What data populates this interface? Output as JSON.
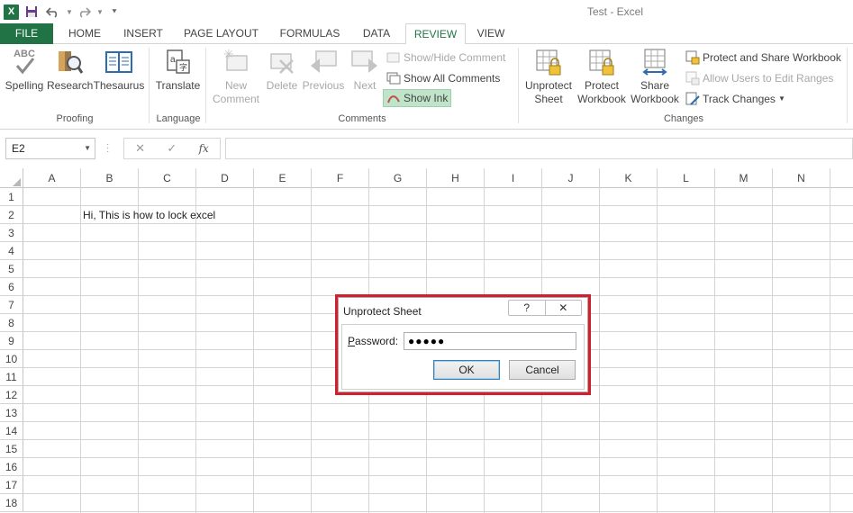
{
  "window": {
    "title": "Test - Excel",
    "app_icon": "X"
  },
  "quick_access": {
    "icons": [
      "excel-logo",
      "save-icon",
      "undo-icon",
      "redo-icon",
      "customize-icon"
    ]
  },
  "tabs": [
    {
      "label": "FILE"
    },
    {
      "label": "HOME"
    },
    {
      "label": "INSERT"
    },
    {
      "label": "PAGE LAYOUT"
    },
    {
      "label": "FORMULAS"
    },
    {
      "label": "DATA"
    },
    {
      "label": "REVIEW"
    },
    {
      "label": "VIEW"
    }
  ],
  "active_tab": "REVIEW",
  "ribbon": {
    "proofing": {
      "label": "Proofing",
      "spelling": "Spelling",
      "spelling_icon_text": "ABC",
      "research": "Research",
      "thesaurus": "Thesaurus"
    },
    "language": {
      "label": "Language",
      "translate": "Translate"
    },
    "comments": {
      "label": "Comments",
      "new_comment_line1": "New",
      "new_comment_line2": "Comment",
      "delete": "Delete",
      "previous": "Previous",
      "next": "Next",
      "show_hide": "Show/Hide Comment",
      "show_all": "Show All Comments",
      "show_ink": "Show Ink"
    },
    "changes": {
      "label": "Changes",
      "unprotect_line1": "Unprotect",
      "unprotect_line2": "Sheet",
      "protect_wb_line1": "Protect",
      "protect_wb_line2": "Workbook",
      "share_line1": "Share",
      "share_line2": "Workbook",
      "protect_share": "Protect and Share Workbook",
      "allow_users": "Allow Users to Edit Ranges",
      "track_changes": "Track Changes"
    }
  },
  "formula_bar": {
    "name_box": "E2",
    "fx": "fx",
    "value": ""
  },
  "columns": [
    "A",
    "B",
    "C",
    "D",
    "E",
    "F",
    "G",
    "H",
    "I",
    "J",
    "K",
    "L",
    "M",
    "N"
  ],
  "rows": [
    "1",
    "2",
    "3",
    "4",
    "5",
    "6",
    "7",
    "8",
    "9",
    "10",
    "11",
    "12",
    "13",
    "14",
    "15",
    "16",
    "17",
    "18"
  ],
  "cells": {
    "B2": "Hi, This is how to lock excel"
  },
  "dialog": {
    "title": "Unprotect Sheet",
    "help": "?",
    "close": "✕",
    "password_label_prefix": "P",
    "password_label_rest": "assword:",
    "password_value": "●●●●●",
    "ok": "OK",
    "cancel": "Cancel"
  },
  "colors": {
    "excel_green": "#217346",
    "highlight_frame": "#d11f2e",
    "show_ink_highlight": "#bfe4c9"
  }
}
